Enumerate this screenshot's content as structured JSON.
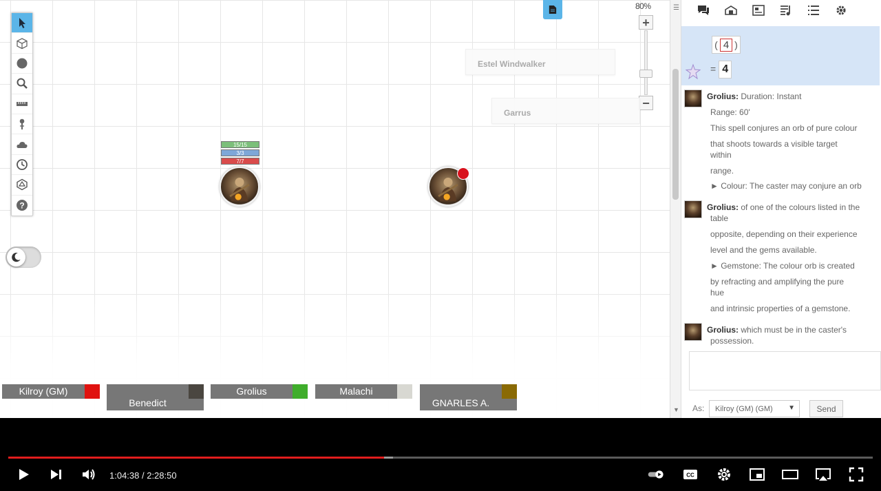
{
  "canvas": {
    "zoom_label": "80%",
    "nameplates": [
      "Estel Windwalker",
      "Garrus"
    ],
    "token_bars": [
      "15/15",
      "3/3",
      "7/7"
    ],
    "colors": {
      "active_tool": "#5bb5e8",
      "status_marker": "#d8121d",
      "bar_green": "#7cbf7a",
      "bar_blue": "#7ea7d8",
      "bar_red": "#d94b4b"
    }
  },
  "toolbar": {
    "tools": [
      "cursor-icon",
      "cube-icon",
      "circle-icon",
      "magnifier-icon",
      "ruler-icon",
      "pin-icon",
      "cloud-icon",
      "clock-icon",
      "dice-icon",
      "help-icon"
    ]
  },
  "players": [
    {
      "name": "Kilroy (GM)",
      "color": "#e0120f"
    },
    {
      "name": "Benedict\nGermaine",
      "color": "#4a4640"
    },
    {
      "name": "Grolius",
      "color": "#3fad2b"
    },
    {
      "name": "Malachi",
      "color": "#d8d8d2"
    },
    {
      "name": "GNARLES A.\nFOESTEPP",
      "color": "#8a6a05"
    }
  ],
  "sidebar": {
    "tabs": [
      "chat-icon",
      "compendium-icon",
      "journal-icon",
      "jukebox-icon",
      "list-icon",
      "settings-icon"
    ],
    "roll": {
      "formula_open": "(",
      "die_value": "4",
      "formula_close": ")",
      "equals": "=",
      "result": "4"
    },
    "messages": [
      {
        "who": "Grolius:",
        "lines": [
          "Duration: Instant",
          "Range: 60'",
          "This spell conjures an orb of pure colour",
          "that shoots towards a visible target",
          "within",
          "range.",
          "► Colour: The caster may conjure an orb"
        ]
      },
      {
        "who": "Grolius:",
        "lines": [
          "of one of the colours listed in the",
          "table",
          "opposite, depending on their experience",
          "level and the gems available.",
          "► Gemstone: The colour orb is created",
          "by refracting and amplifying the pure",
          "hue",
          "and intrinsic properties of a gemstone."
        ]
      },
      {
        "who": "Grolius:",
        "lines": [
          "which must be in the caster's",
          "possession."
        ]
      }
    ],
    "as_label": "As:",
    "as_value": "Kilroy (GM) (GM)",
    "send_label": "Send"
  },
  "video": {
    "current_time": "1:04:38",
    "separator": " / ",
    "duration": "2:28:50",
    "played_fraction": 0.435,
    "loaded_fraction": 0.445
  }
}
